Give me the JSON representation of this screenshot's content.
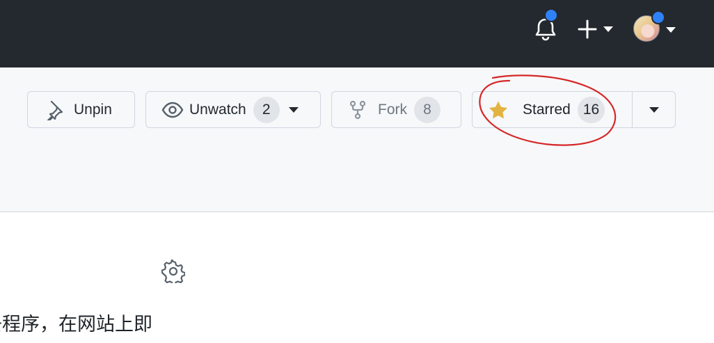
{
  "header": {
    "notifications_icon": "bell-icon",
    "create_icon": "plus-icon",
    "avatar_icon": "avatar"
  },
  "repo_actions": {
    "pin": {
      "label": "Unpin",
      "icon": "pin-icon"
    },
    "watch": {
      "label": "Unwatch",
      "count": "2",
      "icon": "eye-icon"
    },
    "fork": {
      "label": "Fork",
      "count": "8",
      "icon": "fork-icon"
    },
    "star": {
      "label": "Starred",
      "count": "16",
      "icon": "star-filled-icon"
    }
  },
  "annotation": {
    "color": "#d62828",
    "shape": "hand-drawn circle around Starred button"
  },
  "about": {
    "settings_icon": "gear-icon",
    "description": "去程序，在网站上即"
  },
  "colors": {
    "header_bg": "#24292f",
    "notification_dot": "#2f81f7",
    "star": "#e3b341",
    "annotation": "#d62828"
  }
}
